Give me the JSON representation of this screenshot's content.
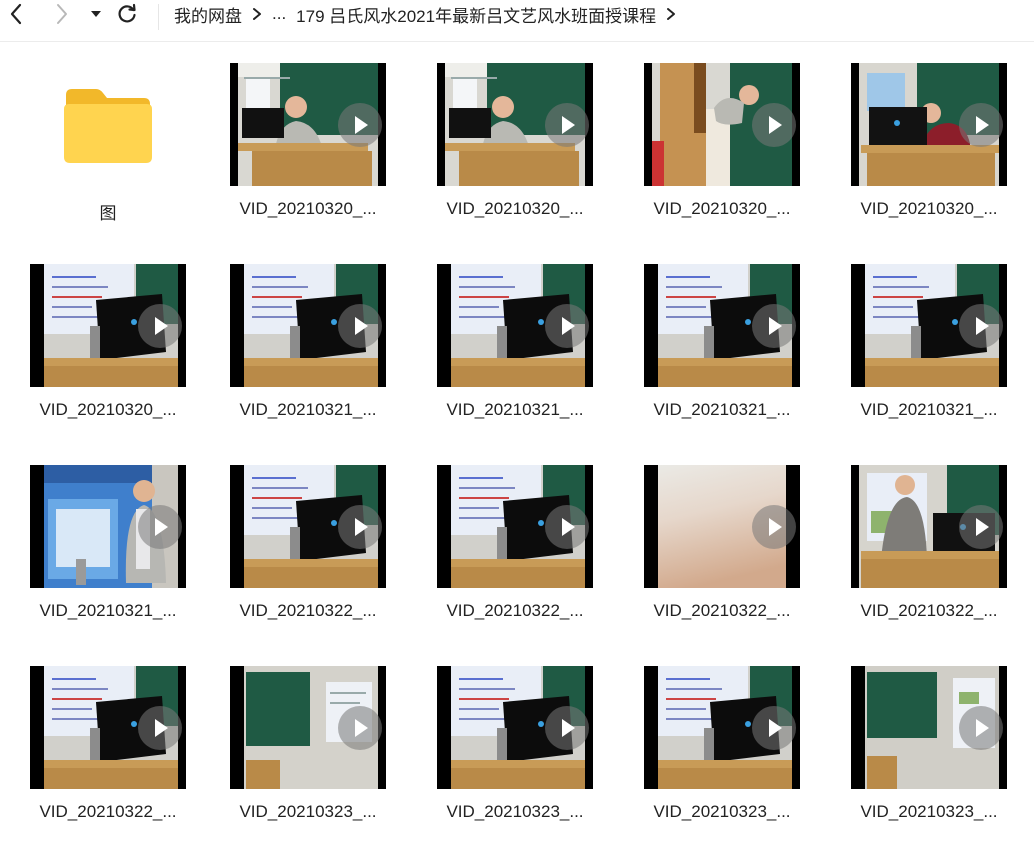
{
  "nav": {
    "back_icon": "chevron-left-icon",
    "forward_icon": "chevron-right-icon",
    "dropdown_icon": "caret-down-icon",
    "refresh_icon": "refresh-icon"
  },
  "breadcrumb": {
    "root": "我的网盘",
    "ellipsis": "...",
    "current": "179 吕氏风水2021年最新吕文艺风水班面授课程"
  },
  "colors": {
    "folder_back": "#f2b82a",
    "folder_front": "#ffd44f",
    "chalkboard": "#1f5a44",
    "screen": "#e9eef7",
    "podium": "#b98a48"
  },
  "items": [
    {
      "type": "folder",
      "name": "图",
      "icon": "folder-icon"
    },
    {
      "type": "video",
      "name": "VID_20210320_...",
      "scene": "lecturer-board"
    },
    {
      "type": "video",
      "name": "VID_20210320_...",
      "scene": "lecturer-board"
    },
    {
      "type": "video",
      "name": "VID_20210320_...",
      "scene": "rotated-lecturer"
    },
    {
      "type": "video",
      "name": "VID_20210320_...",
      "scene": "lecturer-red"
    },
    {
      "type": "video",
      "name": "VID_20210320_...",
      "scene": "screen-laptop"
    },
    {
      "type": "video",
      "name": "VID_20210321_...",
      "scene": "screen-laptop"
    },
    {
      "type": "video",
      "name": "VID_20210321_...",
      "scene": "screen-laptop"
    },
    {
      "type": "video",
      "name": "VID_20210321_...",
      "scene": "screen-laptop"
    },
    {
      "type": "video",
      "name": "VID_20210321_...",
      "scene": "screen-laptop"
    },
    {
      "type": "video",
      "name": "VID_20210321_...",
      "scene": "standing-lecturer"
    },
    {
      "type": "video",
      "name": "VID_20210322_...",
      "scene": "screen-laptop"
    },
    {
      "type": "video",
      "name": "VID_20210322_...",
      "scene": "screen-laptop"
    },
    {
      "type": "video",
      "name": "VID_20210322_...",
      "scene": "blur"
    },
    {
      "type": "video",
      "name": "VID_20210322_...",
      "scene": "standing-lecturer-2"
    },
    {
      "type": "video",
      "name": "VID_20210322_...",
      "scene": "screen-laptop"
    },
    {
      "type": "video",
      "name": "VID_20210323_...",
      "scene": "board-only"
    },
    {
      "type": "video",
      "name": "VID_20210323_...",
      "scene": "screen-laptop"
    },
    {
      "type": "video",
      "name": "VID_20210323_...",
      "scene": "screen-laptop"
    },
    {
      "type": "video",
      "name": "VID_20210323_...",
      "scene": "board-right"
    }
  ]
}
